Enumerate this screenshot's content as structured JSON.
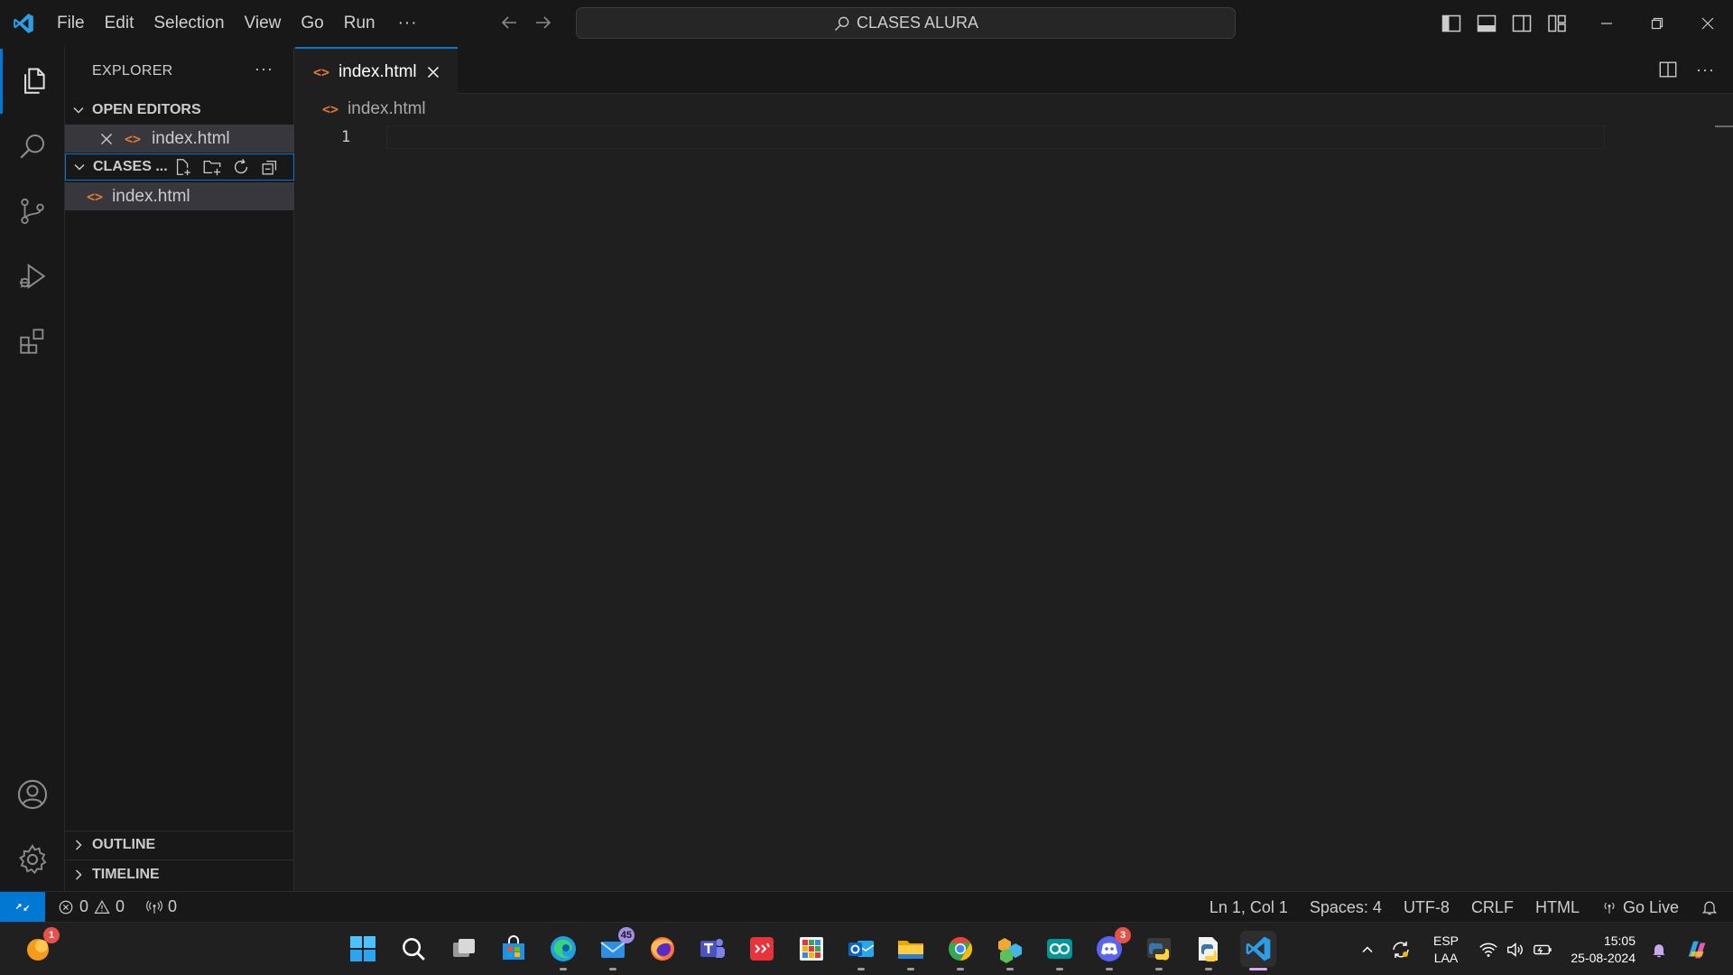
{
  "window": {
    "menu": [
      "File",
      "Edit",
      "Selection",
      "View",
      "Go",
      "Run"
    ],
    "menu_more": "···",
    "command_center": "CLASES ALURA"
  },
  "explorer": {
    "title": "EXPLORER",
    "more": "···",
    "open_editors": {
      "title": "OPEN EDITORS",
      "files": [
        "index.html"
      ]
    },
    "folder": {
      "title": "CLASES ...",
      "files": [
        "index.html"
      ]
    },
    "outline": "OUTLINE",
    "timeline": "TIMELINE"
  },
  "editor": {
    "tab": "index.html",
    "breadcrumb": "index.html",
    "line_numbers": [
      "1"
    ],
    "more": "···"
  },
  "statusbar": {
    "errors": "0",
    "warnings": "0",
    "ports": "0",
    "position": "Ln 1, Col 1",
    "spaces": "Spaces: 4",
    "encoding": "UTF-8",
    "eol": "CRLF",
    "language": "HTML",
    "go_live": "Go Live"
  },
  "taskbar": {
    "apps": [
      {
        "name": "start",
        "running": false
      },
      {
        "name": "search",
        "running": false
      },
      {
        "name": "task-view",
        "running": false
      },
      {
        "name": "microsoft-store",
        "running": false
      },
      {
        "name": "edge",
        "running": true
      },
      {
        "name": "mail",
        "running": true,
        "badge": "45"
      },
      {
        "name": "firefox",
        "running": false
      },
      {
        "name": "teams",
        "running": false
      },
      {
        "name": "calendar-app",
        "running": false
      },
      {
        "name": "bingo-app",
        "running": false
      },
      {
        "name": "outlook",
        "running": true
      },
      {
        "name": "file-explorer",
        "running": true
      },
      {
        "name": "chrome",
        "running": true
      },
      {
        "name": "blocks-app",
        "running": true
      },
      {
        "name": "arduino",
        "running": true
      },
      {
        "name": "discord",
        "running": true,
        "badge": "3"
      },
      {
        "name": "python",
        "running": true
      },
      {
        "name": "python-idle",
        "running": true
      },
      {
        "name": "vscode",
        "running": true,
        "active": true
      }
    ],
    "weather_badge": "1",
    "language_top": "ESP",
    "language_bottom": "LAA",
    "time": "15:05",
    "date": "25-08-2024"
  },
  "colors": {
    "accent": "#0078d4",
    "html_icon": "#e37933",
    "background": "#1f1f1f",
    "chrome": "#181818"
  }
}
